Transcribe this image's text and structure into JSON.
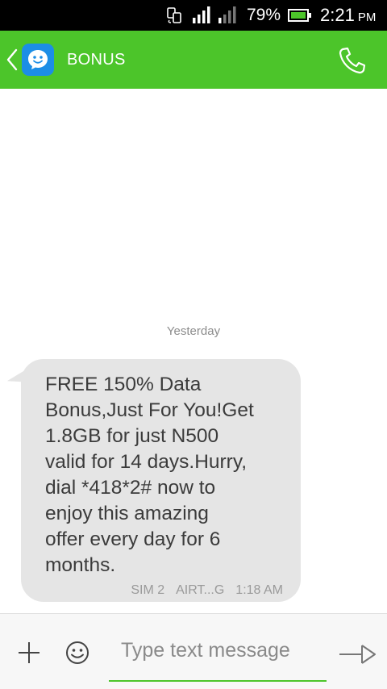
{
  "status_bar": {
    "battery_percent": "79%",
    "time": "2:21",
    "ampm": "PM",
    "icons": [
      "sim-switch-icon",
      "signal-sim1-icon",
      "signal-sim2-icon",
      "battery-icon"
    ]
  },
  "header": {
    "contact_name": "BONUS",
    "icons": [
      "back-arrow-icon",
      "messenger-avatar-icon",
      "phone-icon"
    ]
  },
  "conversation": {
    "date_separator": "Yesterday",
    "messages": [
      {
        "text": "FREE 150% Data\nBonus,Just For You!Get\n1.8GB for just N500\nvalid for 14 days.Hurry,\ndial *418*2# now to\nenjoy this amazing\noffer every day for 6\nmonths.",
        "sim": "SIM 2",
        "carrier": "AIRT...G",
        "time": "1:18 AM"
      }
    ]
  },
  "composer": {
    "placeholder": "Type text message",
    "value": "",
    "icons": [
      "plus-icon",
      "emoji-icon",
      "send-icon"
    ]
  },
  "colors": {
    "accent": "#4cc52a",
    "bubble": "#e5e5e5",
    "avatar": "#1c8ee6"
  }
}
